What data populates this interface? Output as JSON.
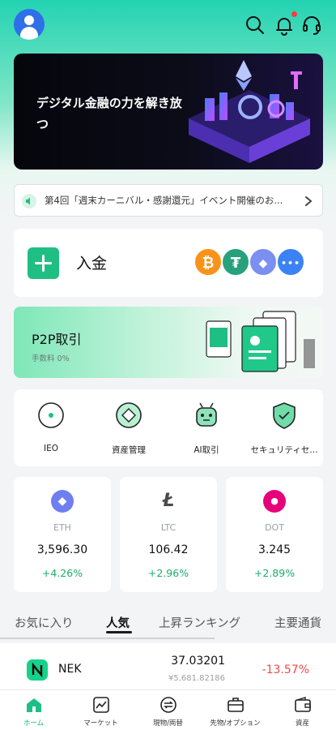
{
  "banner": {
    "headline": "デジタル金融の力を解き放つ"
  },
  "notice": {
    "text": "第4回「週末カーニバル・感謝還元」イベント開催のお..."
  },
  "deposit": {
    "label": "入金",
    "coins": [
      {
        "icon": "bitcoin-icon",
        "glyph": "₿",
        "color": "#f7931a"
      },
      {
        "icon": "tether-icon",
        "glyph": "₮",
        "color": "#26a17b"
      },
      {
        "icon": "ethereum-icon",
        "glyph": "◆",
        "color": "#7b8ff0"
      },
      {
        "icon": "more-icon",
        "glyph": "•••",
        "color": "#3b82f6"
      }
    ]
  },
  "p2p": {
    "title": "P2P取引",
    "subtitle": "手数料 0%"
  },
  "features": [
    {
      "label": "IEO"
    },
    {
      "label": "資産管理"
    },
    {
      "label": "AI取引"
    },
    {
      "label": "セキュリティセ..."
    }
  ],
  "markets": [
    {
      "symbol": "ETH",
      "price": "3,596.30",
      "change": "+4.26%",
      "icon_glyph": "◆",
      "color": "#6f7ff0"
    },
    {
      "symbol": "LTC",
      "price": "106.42",
      "change": "+2.96%",
      "icon_glyph": "Ł",
      "color": "#4a4a4a"
    },
    {
      "symbol": "DOT",
      "price": "3.245",
      "change": "+2.89%",
      "icon_glyph": "●",
      "color": "#e6007a"
    }
  ],
  "tabs": [
    {
      "label": "お気に入り",
      "active": false
    },
    {
      "label": "人気",
      "active": true
    },
    {
      "label": "上昇ランキング",
      "active": false
    },
    {
      "label": "主要通貨",
      "active": false
    }
  ],
  "list": [
    {
      "name": "NEK",
      "price": "37.03201",
      "fiat": "¥5,681.82186",
      "change": "-13.57%"
    }
  ],
  "nav": [
    {
      "label": "ホーム",
      "icon": "home-icon",
      "active": true
    },
    {
      "label": "マーケット",
      "icon": "chart-icon",
      "active": false
    },
    {
      "label": "現物/両替",
      "icon": "exchange-icon",
      "active": false
    },
    {
      "label": "先物/オプション",
      "icon": "briefcase-icon",
      "active": false
    },
    {
      "label": "資産",
      "icon": "wallet-icon",
      "active": false
    }
  ],
  "colors": {
    "accent": "#1fbf83",
    "up": "#1bae6b",
    "down": "#f04a4a"
  }
}
